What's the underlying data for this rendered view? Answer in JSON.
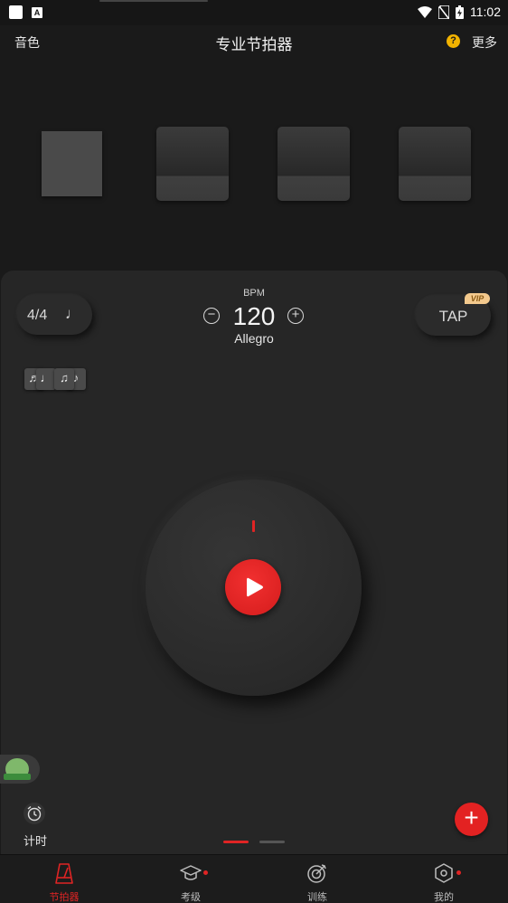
{
  "status_bar": {
    "time": "11:02",
    "badge_letter": "A"
  },
  "header": {
    "sound_label": "音色",
    "title": "专业节拍器",
    "help_glyph": "?",
    "more_label": "更多"
  },
  "controls": {
    "time_signature": "4/4",
    "note_glyph": "♩",
    "bpm_label": "BPM",
    "bpm": "120",
    "tempo_name": "Allegro",
    "minus_glyph": "−",
    "plus_glyph": "+",
    "tap_label": "TAP",
    "vip_label": "VIP"
  },
  "rhythm_cards": [
    "♬",
    "♩",
    "♫",
    "♪"
  ],
  "timer": {
    "label": "计时"
  },
  "fab_glyph": "+",
  "bottom_nav": [
    {
      "label": "节拍器",
      "icon": "metronome-icon",
      "active": true
    },
    {
      "label": "考级",
      "icon": "graduation-cap-icon",
      "active": false
    },
    {
      "label": "训练",
      "icon": "target-icon",
      "active": false
    },
    {
      "label": "我的",
      "icon": "hexagon-gear-icon",
      "active": false
    }
  ],
  "colors": {
    "accent": "#e02424",
    "background": "#1a1a1a",
    "panel": "#262626",
    "help": "#f2b300",
    "vip": "#f3c98d"
  }
}
